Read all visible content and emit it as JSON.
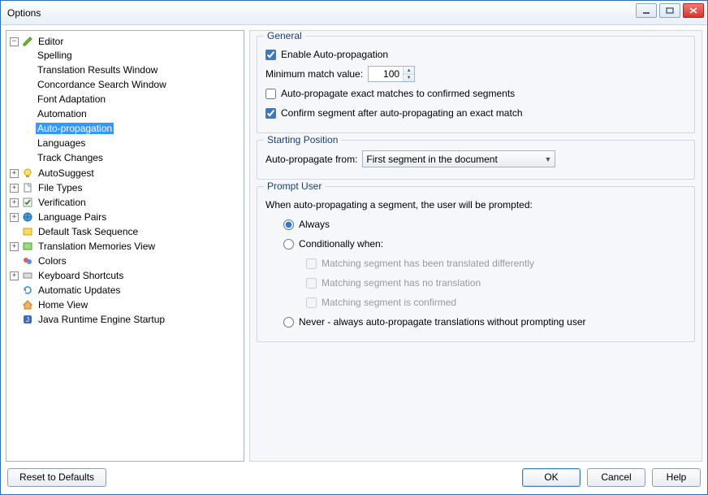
{
  "title": "Options",
  "tree": {
    "editor": {
      "label": "Editor",
      "children": {
        "spelling": "Spelling",
        "trw": "Translation Results Window",
        "csw": "Concordance Search Window",
        "font": "Font Adaptation",
        "auto": "Automation",
        "autoprop": "Auto-propagation",
        "lang": "Languages",
        "track": "Track Changes"
      }
    },
    "autosuggest": "AutoSuggest",
    "filetypes": "File Types",
    "verification": "Verification",
    "langpairs": "Language Pairs",
    "dts": "Default Task Sequence",
    "tmview": "Translation Memories View",
    "colors": "Colors",
    "kbshort": "Keyboard Shortcuts",
    "autoupd": "Automatic Updates",
    "homeview": "Home View",
    "jre": "Java Runtime Engine Startup"
  },
  "general": {
    "title": "General",
    "enable": "Enable Auto-propagation",
    "minmatch_label": "Minimum match value:",
    "minmatch_value": "100",
    "exact": "Auto-propagate exact matches to confirmed segments",
    "confirm": "Confirm segment after auto-propagating an exact match"
  },
  "startpos": {
    "title": "Starting Position",
    "from_label": "Auto-propagate from:",
    "from_value": "First segment in the document"
  },
  "prompt": {
    "title": "Prompt User",
    "intro": "When auto-propagating a segment, the user will be prompted:",
    "always": "Always",
    "cond": "Conditionally when:",
    "c1": "Matching segment has been translated differently",
    "c2": "Matching segment has no translation",
    "c3": "Matching segment is confirmed",
    "never": "Never - always auto-propagate translations without prompting user"
  },
  "footer": {
    "reset": "Reset to Defaults",
    "ok": "OK",
    "cancel": "Cancel",
    "help": "Help"
  }
}
